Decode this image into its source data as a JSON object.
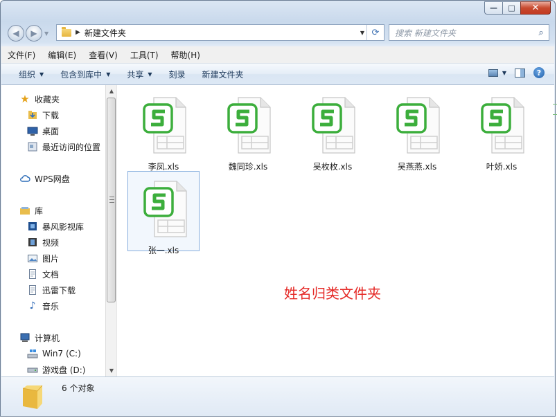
{
  "window": {
    "caption_buttons": {
      "minimize": "—",
      "maximize": "□",
      "close": "✕"
    }
  },
  "address_bar": {
    "path": "新建文件夹",
    "search_placeholder": "搜索 新建文件夹"
  },
  "menu": [
    "文件(F)",
    "编辑(E)",
    "查看(V)",
    "工具(T)",
    "帮助(H)"
  ],
  "toolbar": {
    "organize": "组织",
    "include_in_library": "包含到库中",
    "share": "共享",
    "burn": "刻录",
    "new_folder": "新建文件夹"
  },
  "nav": {
    "favorites": {
      "label": "收藏夹",
      "items": [
        "下载",
        "桌面",
        "最近访问的位置"
      ]
    },
    "wps": {
      "label": "WPS网盘"
    },
    "libraries": {
      "label": "库",
      "items": [
        "暴风影视库",
        "视频",
        "图片",
        "文档",
        "迅雷下载",
        "音乐"
      ]
    },
    "computer": {
      "label": "计算机",
      "items": [
        "Win7 (C:)",
        "游戏盘 (D:)"
      ]
    }
  },
  "files": [
    {
      "name": "李凤.xls",
      "selected": false
    },
    {
      "name": "魏同珍.xls",
      "selected": false
    },
    {
      "name": "吴枚枚.xls",
      "selected": false
    },
    {
      "name": "吴燕燕.xls",
      "selected": false
    },
    {
      "name": "叶娇.xls",
      "selected": false
    },
    {
      "name": "张一.xls",
      "selected": true
    }
  ],
  "annotation": "姓名归类文件夹",
  "status": {
    "count": "6 个对象"
  },
  "colors": {
    "accent_green": "#3cae3c",
    "annotation_red": "#e52a27",
    "selection_border": "#84acdd"
  },
  "icons": {
    "file": "wps-spreadsheet-icon",
    "favorites": "star-icon",
    "download": "download-folder-icon",
    "desktop": "desktop-icon",
    "recent": "recent-places-icon",
    "cloud": "cloud-icon",
    "library": "library-icon",
    "computer": "computer-icon",
    "drive": "drive-icon"
  }
}
